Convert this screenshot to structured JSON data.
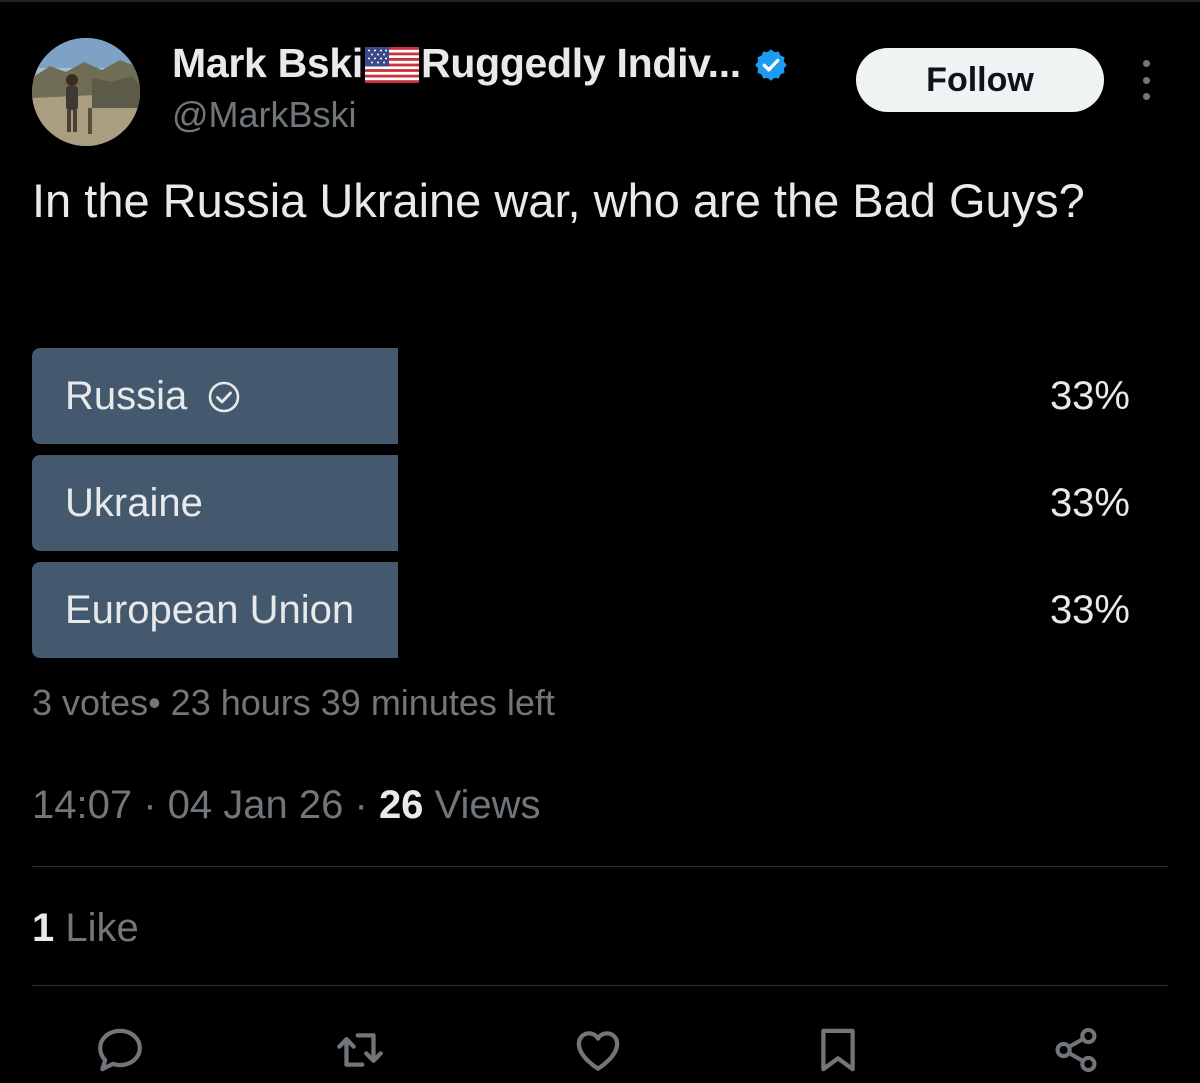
{
  "author": {
    "name": "Mark Bski",
    "name_suffix": "Ruggedly Indiv...",
    "handle": "@MarkBski",
    "flag_icon": "us-flag-icon",
    "verified_icon": "verified-badge-icon"
  },
  "follow_label": "Follow",
  "tweet": {
    "text": "In the Russia Ukraine war, who are the Bad Guys?"
  },
  "poll": {
    "options": [
      {
        "label": "Russia",
        "percent_text": "33%",
        "fraction": 0.33,
        "selected": true
      },
      {
        "label": "Ukraine",
        "percent_text": "33%",
        "fraction": 0.33,
        "selected": false
      },
      {
        "label": "European Union",
        "percent_text": "33%",
        "fraction": 0.33,
        "selected": false
      }
    ],
    "meta": "3 votes• 23 hours 39 minutes left"
  },
  "timestamp": {
    "time": "14:07",
    "date": "04 Jan 26",
    "views_count": "26",
    "views_label": "Views"
  },
  "likes": {
    "count": "1",
    "label": "Like"
  },
  "colors": {
    "background": "#000000",
    "poll_bar": "#44596e",
    "muted_text": "#71767b",
    "primary_text": "#e7e9ea",
    "verified_blue": "#1d9bf0"
  },
  "actions": [
    "reply-icon",
    "retweet-icon",
    "like-icon",
    "bookmark-icon",
    "share-icon"
  ]
}
